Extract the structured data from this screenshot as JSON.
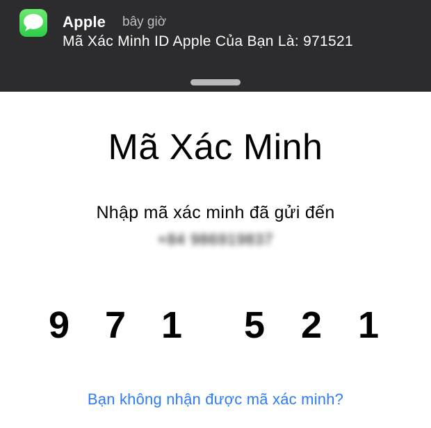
{
  "notification": {
    "app_name": "Apple",
    "timestamp": "bây giờ",
    "message": "Mã Xác Minh ID Apple Của Bạn Là: 971521",
    "icon": "messages-icon"
  },
  "verification": {
    "title": "Mã Xác Minh",
    "subtitle": "Nhập mã xác minh đã gửi đến",
    "phone": "+84 986919837",
    "code": [
      "9",
      "7",
      "1",
      "5",
      "2",
      "1"
    ],
    "resend_link": "Bạn không nhận được mã xác minh?"
  },
  "colors": {
    "banner_bg": "#2c2c2e",
    "link": "#2d7cf6",
    "icon_green": "#34c759"
  }
}
